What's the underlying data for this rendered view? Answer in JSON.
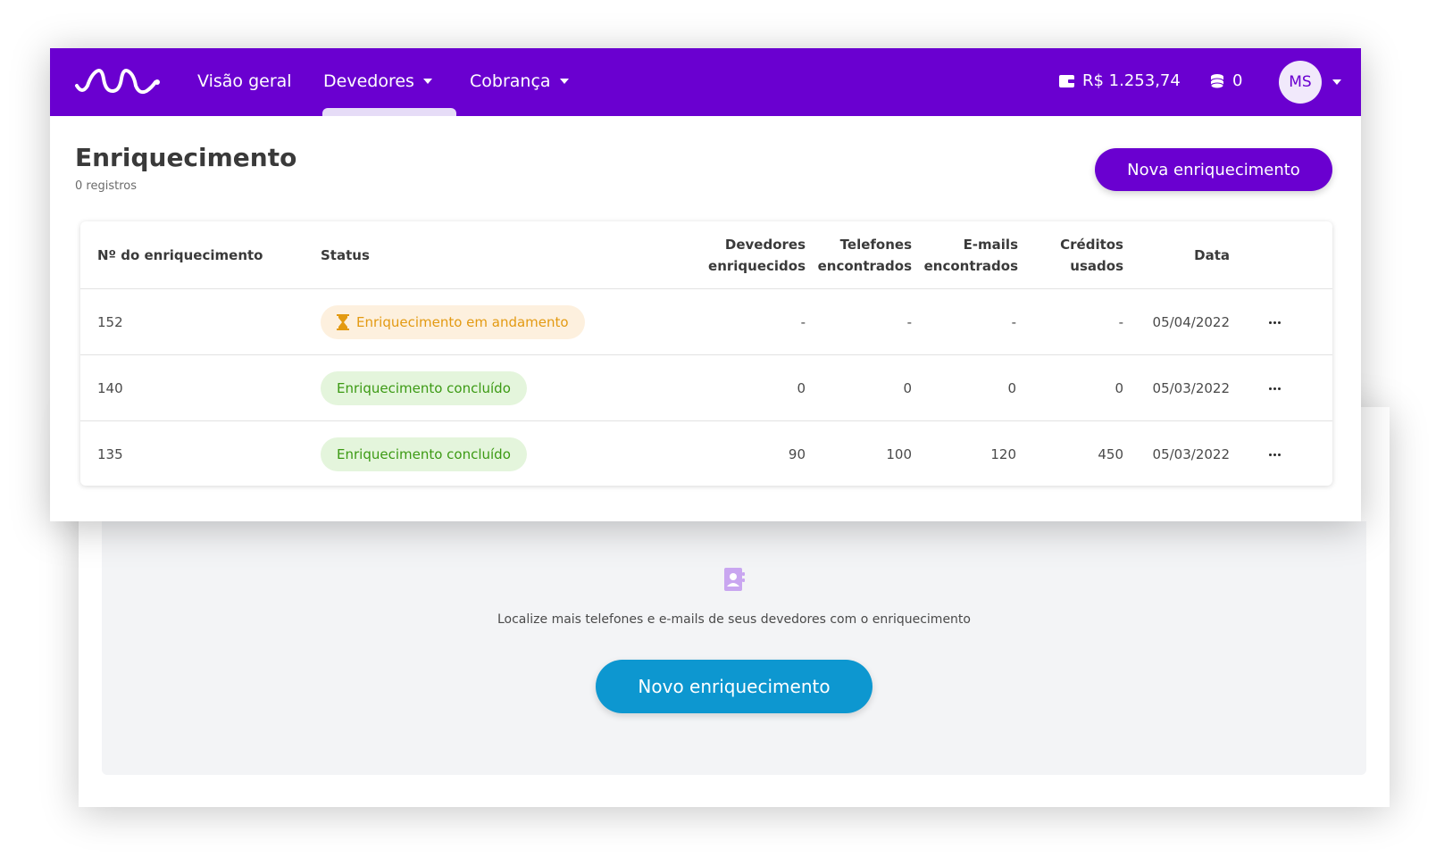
{
  "nav": {
    "items": [
      {
        "label": "Visão geral"
      },
      {
        "label": "Devedores"
      },
      {
        "label": "Cobrança"
      }
    ],
    "balance": "R$ 1.253,74",
    "credits": "0",
    "avatar_initials": "MS"
  },
  "page": {
    "title": "Enriquecimento",
    "subtitle": "0 registros",
    "primary_button": "Nova enriquecimento"
  },
  "table": {
    "headers": {
      "id": "Nº do enriquecimento",
      "status": "Status",
      "devedores_l1": "Devedores",
      "devedores_l2": "enriquecidos",
      "telefones_l1": "Telefones",
      "telefones_l2": "encontrados",
      "emails_l1": "E-mails",
      "emails_l2": "encontrados",
      "creditos_l1": "Créditos",
      "creditos_l2": "usados",
      "data": "Data"
    },
    "rows": [
      {
        "id": "152",
        "status": "Enriquecimento em andamento",
        "status_type": "pending",
        "devedores": "-",
        "telefones": "-",
        "emails": "-",
        "creditos": "-",
        "data": "05/04/2022"
      },
      {
        "id": "140",
        "status": "Enriquecimento concluído",
        "status_type": "done",
        "devedores": "0",
        "telefones": "0",
        "emails": "0",
        "creditos": "0",
        "data": "05/03/2022"
      },
      {
        "id": "135",
        "status": "Enriquecimento concluído",
        "status_type": "done",
        "devedores": "90",
        "telefones": "100",
        "emails": "120",
        "creditos": "450",
        "data": "05/03/2022"
      }
    ]
  },
  "empty_state": {
    "message": "Localize mais telefones e e-mails de seus devedores com o enriquecimento",
    "button": "Novo enriquecimento"
  },
  "colors": {
    "brand_purple": "#6a00d0",
    "cta_blue": "#0d97d0",
    "pending": "#e39a12",
    "done": "#3c9a14"
  },
  "icons": [
    "logo-wave-icon",
    "wallet-icon",
    "coins-icon",
    "hourglass-icon",
    "contact-book-icon",
    "more-options-icon",
    "chevron-down-icon"
  ]
}
